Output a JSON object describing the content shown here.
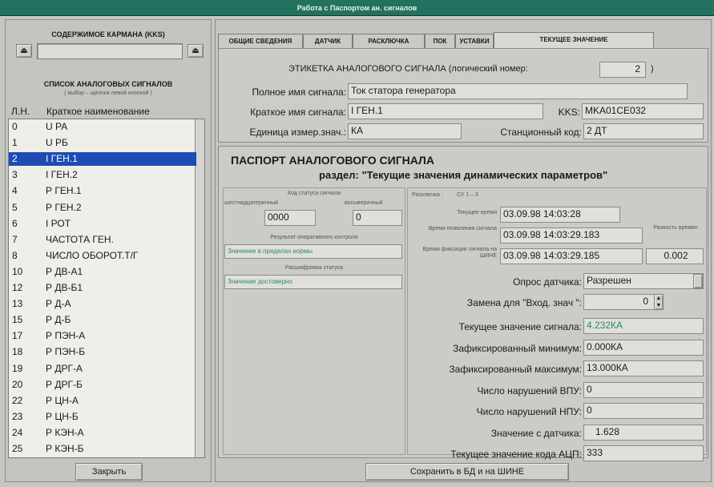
{
  "window": {
    "title": "Работа с Паспортом ан. сигналов"
  },
  "left": {
    "pocket_title": "СОДЕРЖИМОЕ КАРМАНА (KKS)",
    "list_title": "СПИСОК АНАЛОГОВЫХ СИГНАЛОВ",
    "list_hint": "( выбор – щелчок левой кнопкой )",
    "col_num": "Л.Н.",
    "col_name": "Краткое наименование",
    "items": [
      {
        "n": "0",
        "t": "U РА"
      },
      {
        "n": "1",
        "t": "U РБ"
      },
      {
        "n": "2",
        "t": "I ГЕН.1"
      },
      {
        "n": "3",
        "t": "I ГЕН.2"
      },
      {
        "n": "4",
        "t": "Р ГЕН.1"
      },
      {
        "n": "5",
        "t": "Р ГЕН.2"
      },
      {
        "n": "6",
        "t": "I РОТ"
      },
      {
        "n": "7",
        "t": "ЧАСТОТА ГЕН."
      },
      {
        "n": "8",
        "t": "ЧИСЛО ОБОРОТ.Т/Г"
      },
      {
        "n": "10",
        "t": "Р ДВ-А1"
      },
      {
        "n": "12",
        "t": "Р ДВ-Б1"
      },
      {
        "n": "13",
        "t": "Р Д-А"
      },
      {
        "n": "15",
        "t": "Р Д-Б"
      },
      {
        "n": "17",
        "t": "Р ПЭН-А"
      },
      {
        "n": "18",
        "t": "Р ПЭН-Б"
      },
      {
        "n": "19",
        "t": "Р ДРГ-А"
      },
      {
        "n": "20",
        "t": "Р ДРГ-Б"
      },
      {
        "n": "22",
        "t": "Р ЦН-А"
      },
      {
        "n": "23",
        "t": "Р ЦН-Б"
      },
      {
        "n": "24",
        "t": "Р КЭН-А"
      },
      {
        "n": "25",
        "t": "Р КЭН-Б"
      }
    ],
    "selected_index": 2,
    "close_label": "Закрыть"
  },
  "tabs": [
    "ОБЩИЕ СВЕДЕНИЯ",
    "ДАТЧИК",
    "РАСКЛЮЧКА",
    "ПОК",
    "УСТАВКИ",
    "ТЕКУЩЕЕ ЗНАЧЕНИЕ"
  ],
  "label_box": {
    "heading": "ЭТИКЕТКА АНАЛОГОВОГО СИГНАЛА (логический номер:",
    "logical_number": "2",
    "close_paren": ")",
    "full_name_label": "Полное имя сигнала:",
    "full_name": "Ток статора генератора",
    "short_name_label": "Краткое имя сигнала:",
    "short_name": "I ГЕН.1",
    "kks_label": "KKS:",
    "kks": "MKA01CE032",
    "unit_label": "Единица измер.знач.:",
    "unit": "КА",
    "station_code_label": "Станционный код:",
    "station_code": "2 ДТ"
  },
  "passport": {
    "title": "ПАСПОРТ АНАЛОГОВОГО СИГНАЛА",
    "subtitle": "раздел: \"Текущие значения динамических параметров\"",
    "status_code_label": "Код статуса сигнала",
    "hex_label": "шестнадцатеричный",
    "oct_label": "восьмеричный",
    "hex_value": "0000",
    "oct_value": "0",
    "op_control_label": "Результат оперативного контроля",
    "op_control_value": "Значение в пределах нормы",
    "status_decode_label": "Расшифровка статуса",
    "status_decode_value": "Значение достоверно",
    "rasklyuchka_label": "Расключка :",
    "rasklyuchka_value": "СУ  1   –  3",
    "current_time_label": "Текущее время",
    "current_time": "03.09.98   14:03:28",
    "appear_time_label": "Время появления сигнала",
    "appear_time": "03.09.98   14:03:29.183",
    "fix_time_label": "Время фиксации сигнала на ШИНЕ",
    "fix_time": "03.09.98   14:03:29.185",
    "diff_label": "Разность времен",
    "diff_value": "0.002",
    "poll_label": "Опрос датчика:",
    "poll_value": "Разрешен",
    "replace_label": "Замена для \"Вход. знач \":",
    "replace_value": "0",
    "cur_value_label": "Текущее значение сигнала:",
    "cur_value": "4.232КА",
    "min_label": "Зафиксированный минимум:",
    "min_value": "0.000КА",
    "max_label": "Зафиксированный максимум:",
    "max_value": "13.000КА",
    "vpu_label": "Число нарушений ВПУ:",
    "vpu_value": "0",
    "npu_label": "Число нарушений НПУ:",
    "npu_value": "0",
    "sensor_label": "Значение с датчика:",
    "sensor_value": "1.628",
    "adc_label": "Текущее значение кода АЦП:",
    "adc_value": "333"
  },
  "save_label": "Сохранить в БД и на ШИНЕ",
  "colors": {
    "title_bar": "#23715f",
    "selection": "#1e4bb5",
    "green_text": "#2e8b57"
  }
}
